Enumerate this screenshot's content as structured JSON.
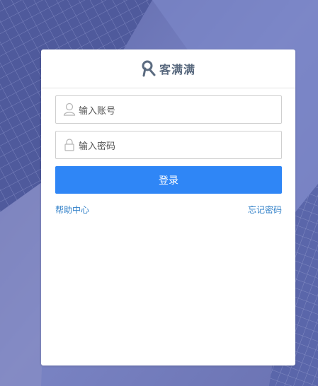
{
  "logo": {
    "brand_name": "客满满",
    "icon": "brand-logo-icon",
    "color": "#5b6b80"
  },
  "form": {
    "username_placeholder": "输入账号",
    "username_value": "",
    "username_icon": "user-icon",
    "password_placeholder": "输入密码",
    "password_value": "",
    "password_icon": "lock-icon",
    "login_label": "登录"
  },
  "links": {
    "help": "帮助中心",
    "forgot_password": "忘记密码"
  },
  "colors": {
    "primary_button": "#2f86f6",
    "link": "#2f7fc8",
    "background": "#6f79b8"
  }
}
